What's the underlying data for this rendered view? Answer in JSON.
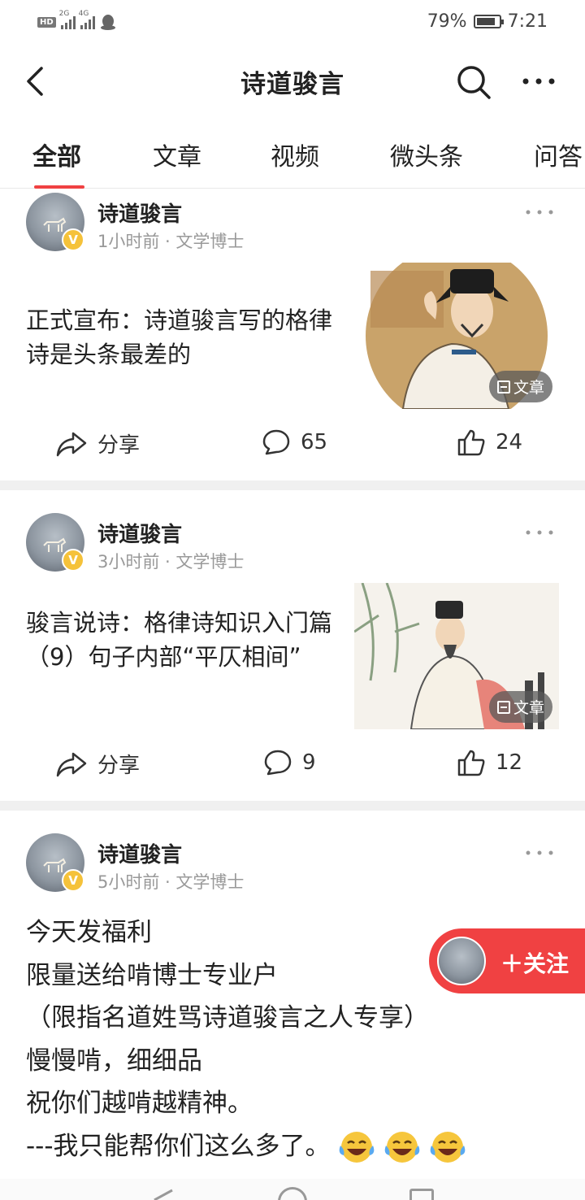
{
  "status_bar": {
    "hd": "HD",
    "sig1_label": "2G",
    "sig2_label": "4G",
    "battery_pct": "79%",
    "time": "7:21"
  },
  "header": {
    "title": "诗道骏言"
  },
  "tabs": [
    {
      "label": "全部",
      "active": true
    },
    {
      "label": "文章"
    },
    {
      "label": "视频"
    },
    {
      "label": "微头条"
    },
    {
      "label": "问答"
    }
  ],
  "posts": [
    {
      "author": "诗道骏言",
      "meta": "1小时前 · 文学博士",
      "title": "正式宣布：诗道骏言写的格律诗是头条最差的",
      "thumb_tag": "文章",
      "share_label": "分享",
      "comments": "65",
      "likes": "24"
    },
    {
      "author": "诗道骏言",
      "meta": "3小时前 · 文学博士",
      "title": "骏言说诗：格律诗知识入门篇（9）句子内部“平仄相间”",
      "thumb_tag": "文章",
      "share_label": "分享",
      "comments": "9",
      "likes": "12"
    },
    {
      "author": "诗道骏言",
      "meta": "5小时前 · 文学博士",
      "lines": [
        "今天发福利",
        "限量送给啃博士专业户",
        "（限指名道姓骂诗道骏言之人专享）",
        "慢慢啃，细细品",
        "祝你们越啃越精神。",
        "---我只能帮你们这么多了。"
      ]
    }
  ],
  "follow": {
    "label": "＋关注"
  },
  "colors": {
    "accent": "#f04142",
    "verified": "#f5c23a"
  }
}
